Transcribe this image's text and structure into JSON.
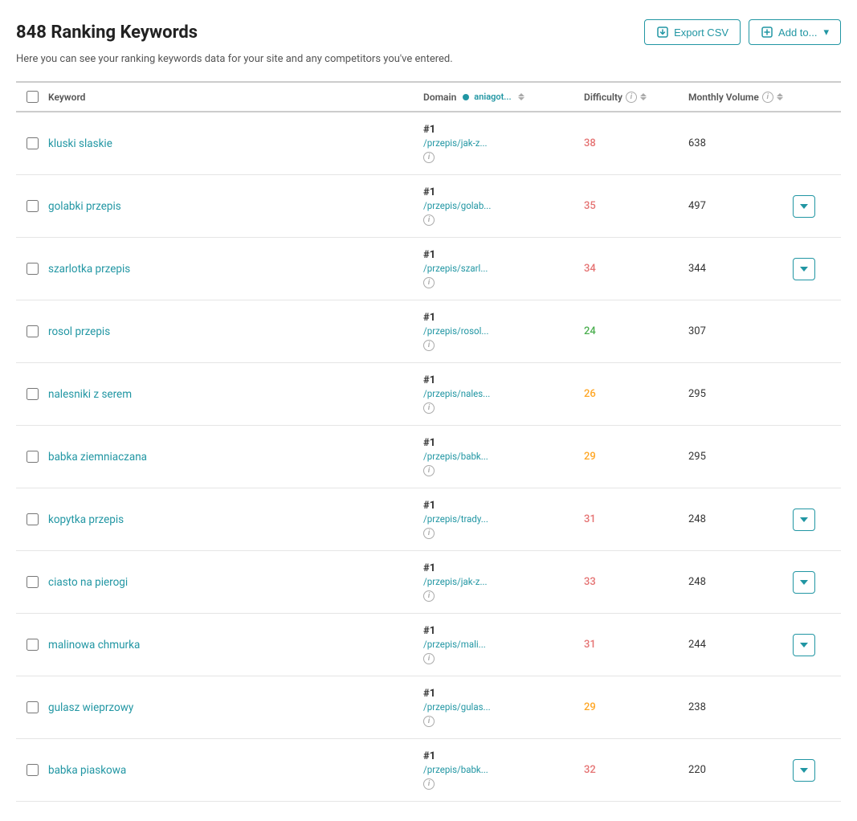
{
  "title": "848 Ranking Keywords",
  "subtitle": "Here you can see your ranking keywords data for your site and any competitors you've entered.",
  "actions": {
    "export_label": "Export CSV",
    "add_label": "Add to..."
  },
  "columns": {
    "keyword": "Keyword",
    "domain": "Domain",
    "domain_name": "aniagot...",
    "difficulty": "Difficulty",
    "monthly_volume": "Monthly Volume"
  },
  "rows": [
    {
      "id": 1,
      "keyword": "kluski slaskie",
      "rank": "#1",
      "url": "/przepis/jak-z...",
      "difficulty": 38,
      "volume": 638,
      "has_expand": false
    },
    {
      "id": 2,
      "keyword": "golabki przepis",
      "rank": "#1",
      "url": "/przepis/golab...",
      "difficulty": 35,
      "volume": 497,
      "has_expand": true
    },
    {
      "id": 3,
      "keyword": "szarlotka przepis",
      "rank": "#1",
      "url": "/przepis/szarl...",
      "difficulty": 34,
      "volume": 344,
      "has_expand": true
    },
    {
      "id": 4,
      "keyword": "rosol przepis",
      "rank": "#1",
      "url": "/przepis/rosol...",
      "difficulty": 24,
      "volume": 307,
      "has_expand": false
    },
    {
      "id": 5,
      "keyword": "nalesniki z serem",
      "rank": "#1",
      "url": "/przepis/nales...",
      "difficulty": 26,
      "volume": 295,
      "has_expand": false
    },
    {
      "id": 6,
      "keyword": "babka ziemniaczana",
      "rank": "#1",
      "url": "/przepis/babk...",
      "difficulty": 29,
      "volume": 295,
      "has_expand": false
    },
    {
      "id": 7,
      "keyword": "kopytka przepis",
      "rank": "#1",
      "url": "/przepis/trady...",
      "difficulty": 31,
      "volume": 248,
      "has_expand": true
    },
    {
      "id": 8,
      "keyword": "ciasto na pierogi",
      "rank": "#1",
      "url": "/przepis/jak-z...",
      "difficulty": 33,
      "volume": 248,
      "has_expand": true
    },
    {
      "id": 9,
      "keyword": "malinowa chmurka",
      "rank": "#1",
      "url": "/przepis/mali...",
      "difficulty": 31,
      "volume": 244,
      "has_expand": true
    },
    {
      "id": 10,
      "keyword": "gulasz wieprzowy",
      "rank": "#1",
      "url": "/przepis/gulas...",
      "difficulty": 29,
      "volume": 238,
      "has_expand": false
    },
    {
      "id": 11,
      "keyword": "babka piaskowa",
      "rank": "#1",
      "url": "/przepis/babk...",
      "difficulty": 32,
      "volume": 220,
      "has_expand": true
    }
  ]
}
